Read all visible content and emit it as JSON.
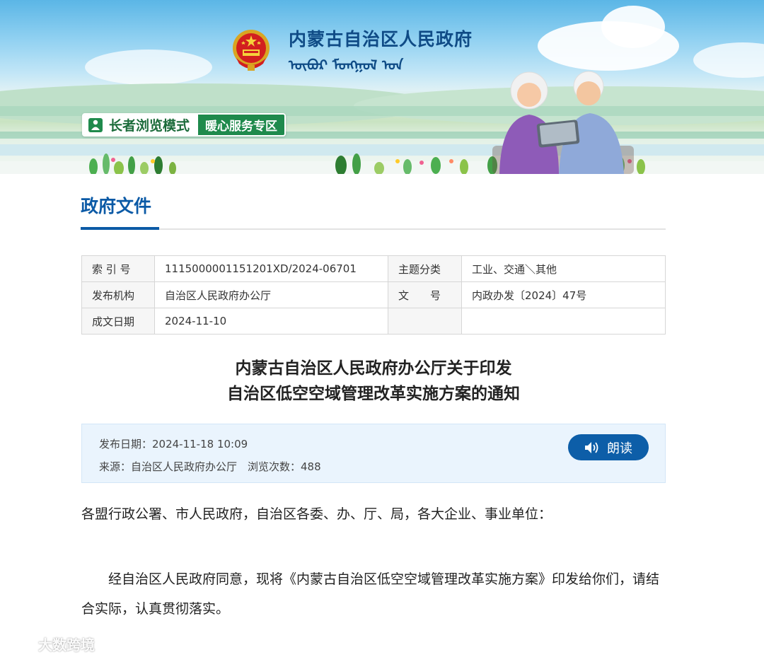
{
  "header": {
    "gov_name": "内蒙古自治区人民政府",
    "mongolian_script": "ᠥᠪᠦᠷ ᠮᠣᠩᠭᠣᠯ ᠤᠨ",
    "elder_mode_label": "长者浏览模式",
    "warm_service_label": "暖心服务专区"
  },
  "section": {
    "title": "政府文件"
  },
  "meta_table": {
    "index_label": "索 引 号",
    "index_value": "1115000001151201XD/2024-06701",
    "topic_label": "主题分类",
    "topic_value": "工业、交通＼其他",
    "issuer_label": "发布机构",
    "issuer_value": "自治区人民政府办公厅",
    "docno_label": "文　　号",
    "docno_value": "内政办发〔2024〕47号",
    "date_label": "成文日期",
    "date_value": "2024-11-10"
  },
  "document": {
    "title_line1": "内蒙古自治区人民政府办公厅关于印发",
    "title_line2": "自治区低空空域管理改革实施方案的通知",
    "publish_line": "发布日期：2024-11-18 10:09",
    "source_line": "来源：自治区人民政府办公厅　浏览次数：488",
    "read_button": "朗读",
    "salutation": "各盟行政公署、市人民政府，自治区各委、办、厅、局，各大企业、事业单位：",
    "paragraph": "　　经自治区人民政府同意，现将《内蒙古自治区低空空域管理改革实施方案》印发给你们，请结合实际，认真贯彻落实。"
  },
  "watermark": {
    "text": "大数跨境"
  },
  "colors": {
    "brand_blue": "#0b5aa6",
    "button_blue": "#0d5ea8",
    "elder_green": "#1f8a4c",
    "info_bg": "#eaf4fd"
  }
}
